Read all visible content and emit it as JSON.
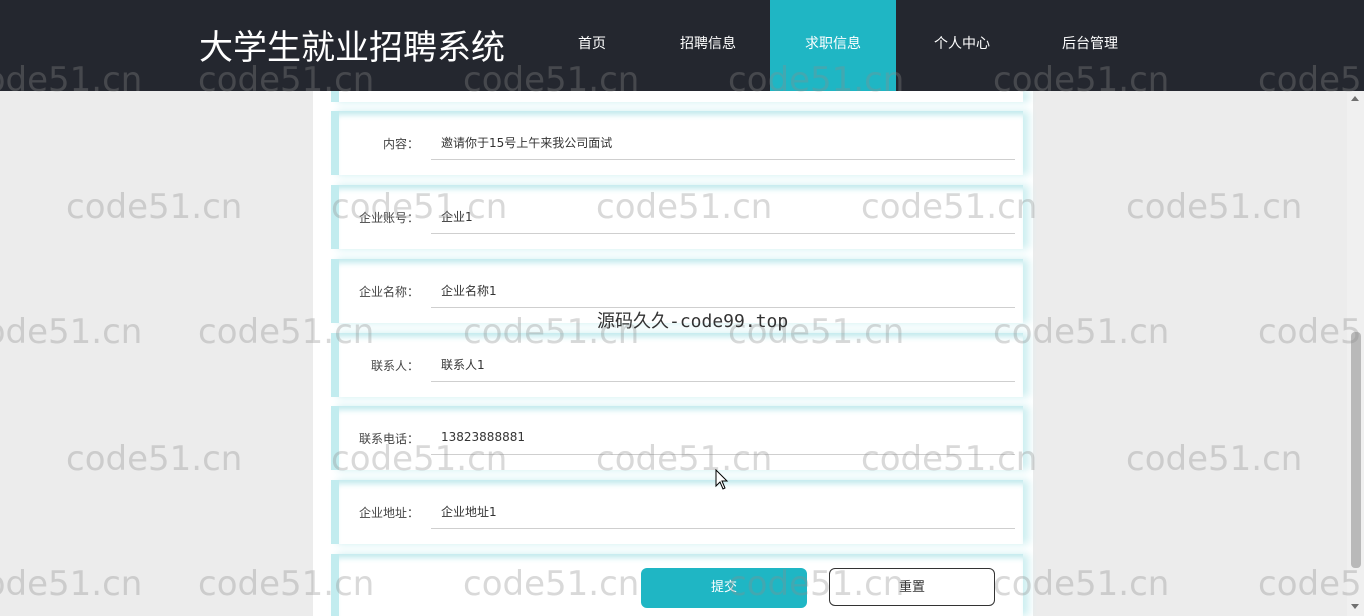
{
  "header": {
    "brand": "大学生就业招聘系统",
    "nav": [
      {
        "label": "首页"
      },
      {
        "label": "招聘信息"
      },
      {
        "label": "求职信息"
      },
      {
        "label": "个人中心"
      },
      {
        "label": "后台管理"
      }
    ],
    "active_nav": "求职信息"
  },
  "form": {
    "fields": [
      {
        "label": "内容：",
        "value": "邀请你于15号上午来我公司面试"
      },
      {
        "label": "企业账号：",
        "value": "企业1"
      },
      {
        "label": "企业名称：",
        "value": "企业名称1"
      },
      {
        "label": "联系人：",
        "value": "联系人1"
      },
      {
        "label": "联系电话：",
        "value": "13823888881"
      },
      {
        "label": "企业地址：",
        "value": "企业地址1"
      }
    ],
    "submit_label": "提交",
    "reset_label": "重置"
  },
  "watermark": {
    "text": "code51.cn",
    "center_text": "源码久久-code99.top"
  },
  "colors": {
    "header_bg": "#24272f",
    "accent": "#1fb6c4",
    "page_bg": "#ececec"
  }
}
